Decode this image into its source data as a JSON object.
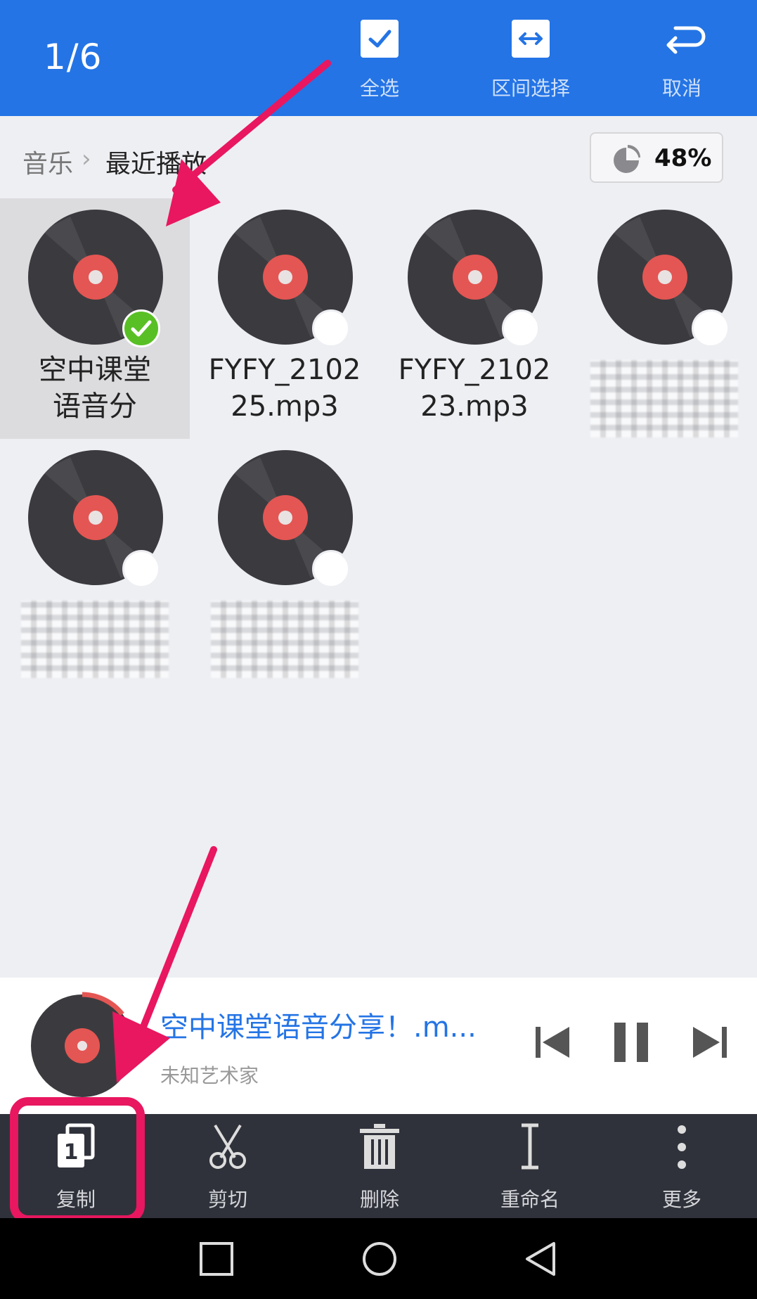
{
  "header": {
    "counter": "1/6",
    "select_all_label": "全选",
    "range_select_label": "区间选择",
    "cancel_label": "取消"
  },
  "breadcrumb": {
    "root": "音乐",
    "current": "最近播放"
  },
  "storage": {
    "percent_text": "48%",
    "percent": 48
  },
  "files": [
    {
      "name_line1": "空中课堂",
      "name_line2": "语音分",
      "selected": true
    },
    {
      "name_line1": "FYFY_2102",
      "name_line2": "25.mp3",
      "selected": false
    },
    {
      "name_line1": "FYFY_2102",
      "name_line2": "23.mp3",
      "selected": false
    },
    {
      "name_line1": "",
      "name_line2": "",
      "selected": false
    },
    {
      "name_line1": "",
      "name_line2": "",
      "selected": false
    },
    {
      "name_line1": "",
      "name_line2": "",
      "selected": false
    }
  ],
  "now_playing": {
    "title": "空中课堂语音分享！.m...",
    "artist": "未知艺术家"
  },
  "actions": {
    "copy": "复制",
    "cut": "剪切",
    "delete": "删除",
    "rename": "重命名",
    "more": "更多"
  },
  "colors": {
    "header_blue": "#2474e5",
    "selected_green": "#58c024",
    "annotation_pink": "#e8175f",
    "action_bar": "#30323b"
  }
}
